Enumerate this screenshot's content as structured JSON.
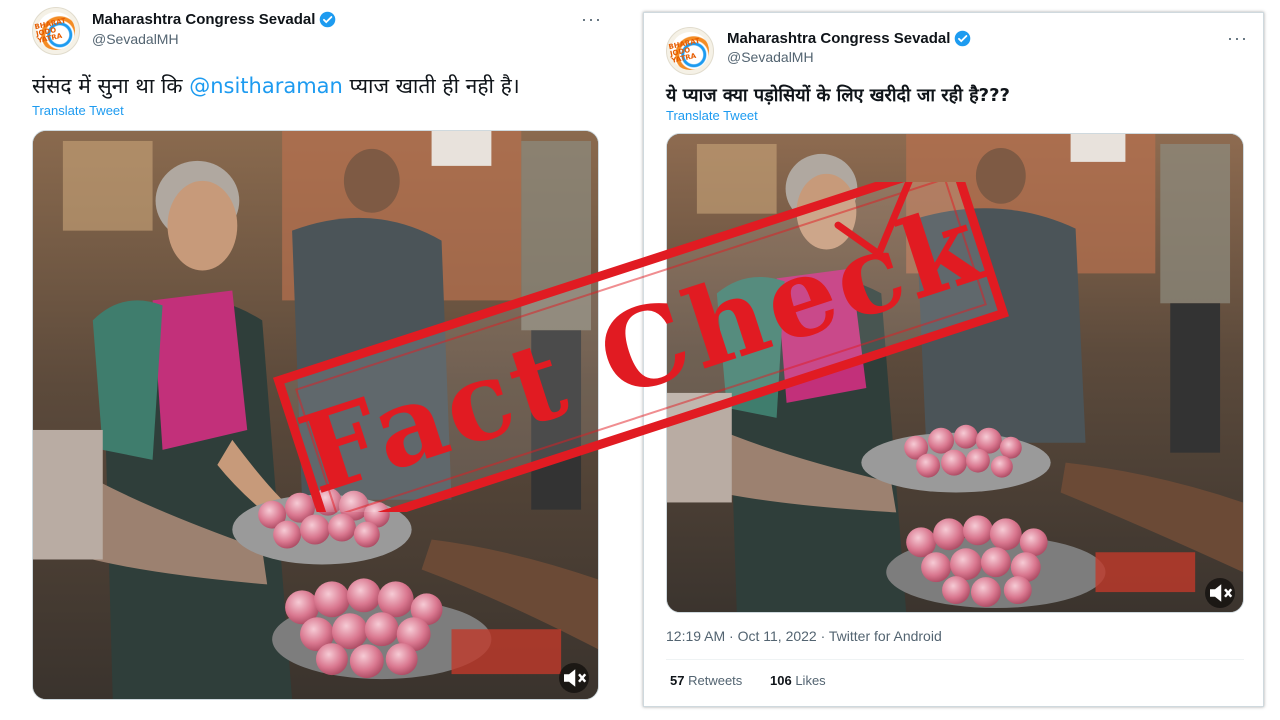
{
  "left_tweet": {
    "author_name": "Maharashtra Congress Sevadal",
    "handle": "@SevadalMH",
    "avatar_text": "BHARAT JODO YATRA",
    "text_before": "संसद में सुना था कि ",
    "mention": "@nsitharaman",
    "text_after": " प्याज खाती ही नही है।",
    "translate_label": "Translate Tweet"
  },
  "right_tweet": {
    "author_name": "Maharashtra Congress Sevadal",
    "handle": "@SevadalMH",
    "avatar_text": "BHARAT JODO YATRA",
    "text": "ये प्याज क्या पड़ोसियों के लिए खरीदी जा रही है???",
    "translate_label": "Translate Tweet",
    "timestamp": "12:19 AM · Oct 11, 2022 · Twitter for Android",
    "retweets_count": "57",
    "retweets_label": "Retweets",
    "likes_count": "106",
    "likes_label": "Likes"
  },
  "stamp": {
    "text": "Fact Check",
    "color": "#e11b22"
  },
  "icons": {
    "verified": "verified-badge-icon",
    "more": "more-options-icon",
    "mute": "volume-muted-icon"
  },
  "colors": {
    "link": "#1d9bf0",
    "secondary_text": "#536471",
    "stamp_red": "#e11b22"
  }
}
